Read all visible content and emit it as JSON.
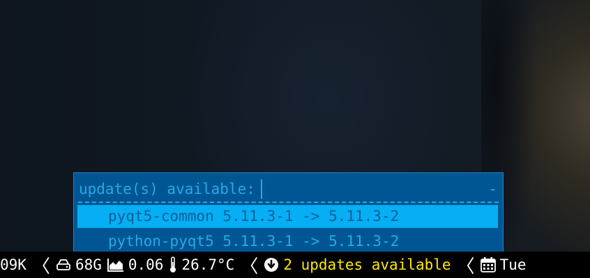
{
  "popup": {
    "prompt": "update(s) available:",
    "prompt_indicator": "-",
    "items": [
      {
        "label": "pyqt5-common 5.11.3-1 -> 5.11.3-2",
        "selected": true
      },
      {
        "label": "python-pyqt5 5.11.3-1 -> 5.11.3-2",
        "selected": false
      }
    ]
  },
  "statusbar": {
    "net_partial": "09K",
    "disk": "68G",
    "load": "0.06",
    "temperature": "26.7°C",
    "updates": "2 updates available",
    "date_partial": "Tue",
    "separator_glyph": "〈"
  },
  "colors": {
    "popup_bg": "#005693",
    "popup_text": "#27a9e8",
    "selected_bg": "#06aef3",
    "selected_text": "#0b5f9b",
    "bar_bg": "#000000",
    "updates_text": "#ffea00"
  },
  "icons": [
    "hdd-icon",
    "area-chart-icon",
    "thermometer-icon",
    "arrow-circle-down-icon",
    "calendar-icon"
  ]
}
